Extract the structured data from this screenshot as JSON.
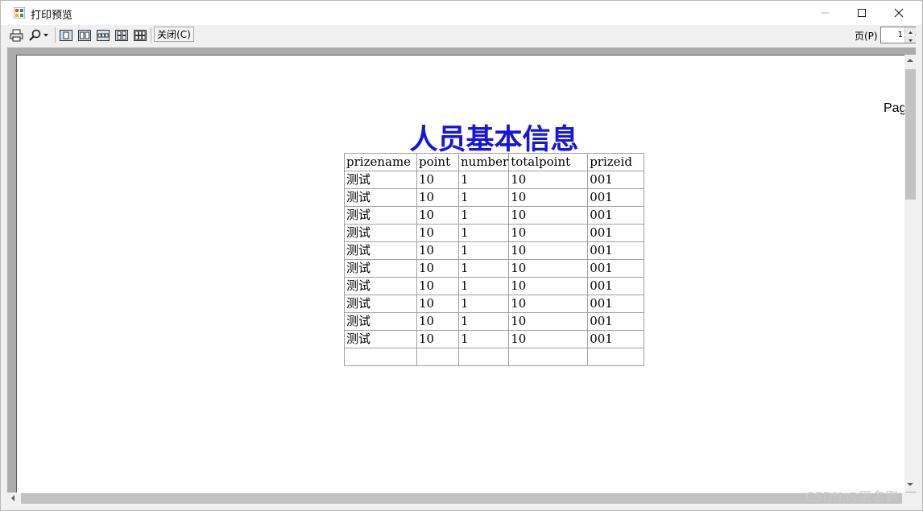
{
  "window": {
    "title": "打印预览"
  },
  "toolbar": {
    "print_icon": "printer-icon",
    "zoom_icon": "magnifier-icon",
    "layouts": [
      "one-page-icon",
      "two-pages-icon",
      "three-pages-icon",
      "four-pages-icon",
      "six-pages-icon"
    ],
    "close_label": "关闭(C)",
    "page_label": "页(P)",
    "page_value": "1"
  },
  "report": {
    "page_text": "Pag",
    "title": "人员基本信息",
    "title_color": "#1515e0",
    "columns": [
      "prizename",
      "point",
      "number",
      "totalpoint",
      "prizeid"
    ],
    "rows": [
      [
        "测试",
        "10",
        "1",
        "10",
        "001"
      ],
      [
        "测试",
        "10",
        "1",
        "10",
        "001"
      ],
      [
        "测试",
        "10",
        "1",
        "10",
        "001"
      ],
      [
        "测试",
        "10",
        "1",
        "10",
        "001"
      ],
      [
        "测试",
        "10",
        "1",
        "10",
        "001"
      ],
      [
        "测试",
        "10",
        "1",
        "10",
        "001"
      ],
      [
        "测试",
        "10",
        "1",
        "10",
        "001"
      ],
      [
        "测试",
        "10",
        "1",
        "10",
        "001"
      ],
      [
        "测试",
        "10",
        "1",
        "10",
        "001"
      ],
      [
        "测试",
        "10",
        "1",
        "10",
        "001"
      ],
      [
        "",
        "",
        "",
        "",
        ""
      ]
    ]
  },
  "watermark": "CSDN @匿名劉"
}
